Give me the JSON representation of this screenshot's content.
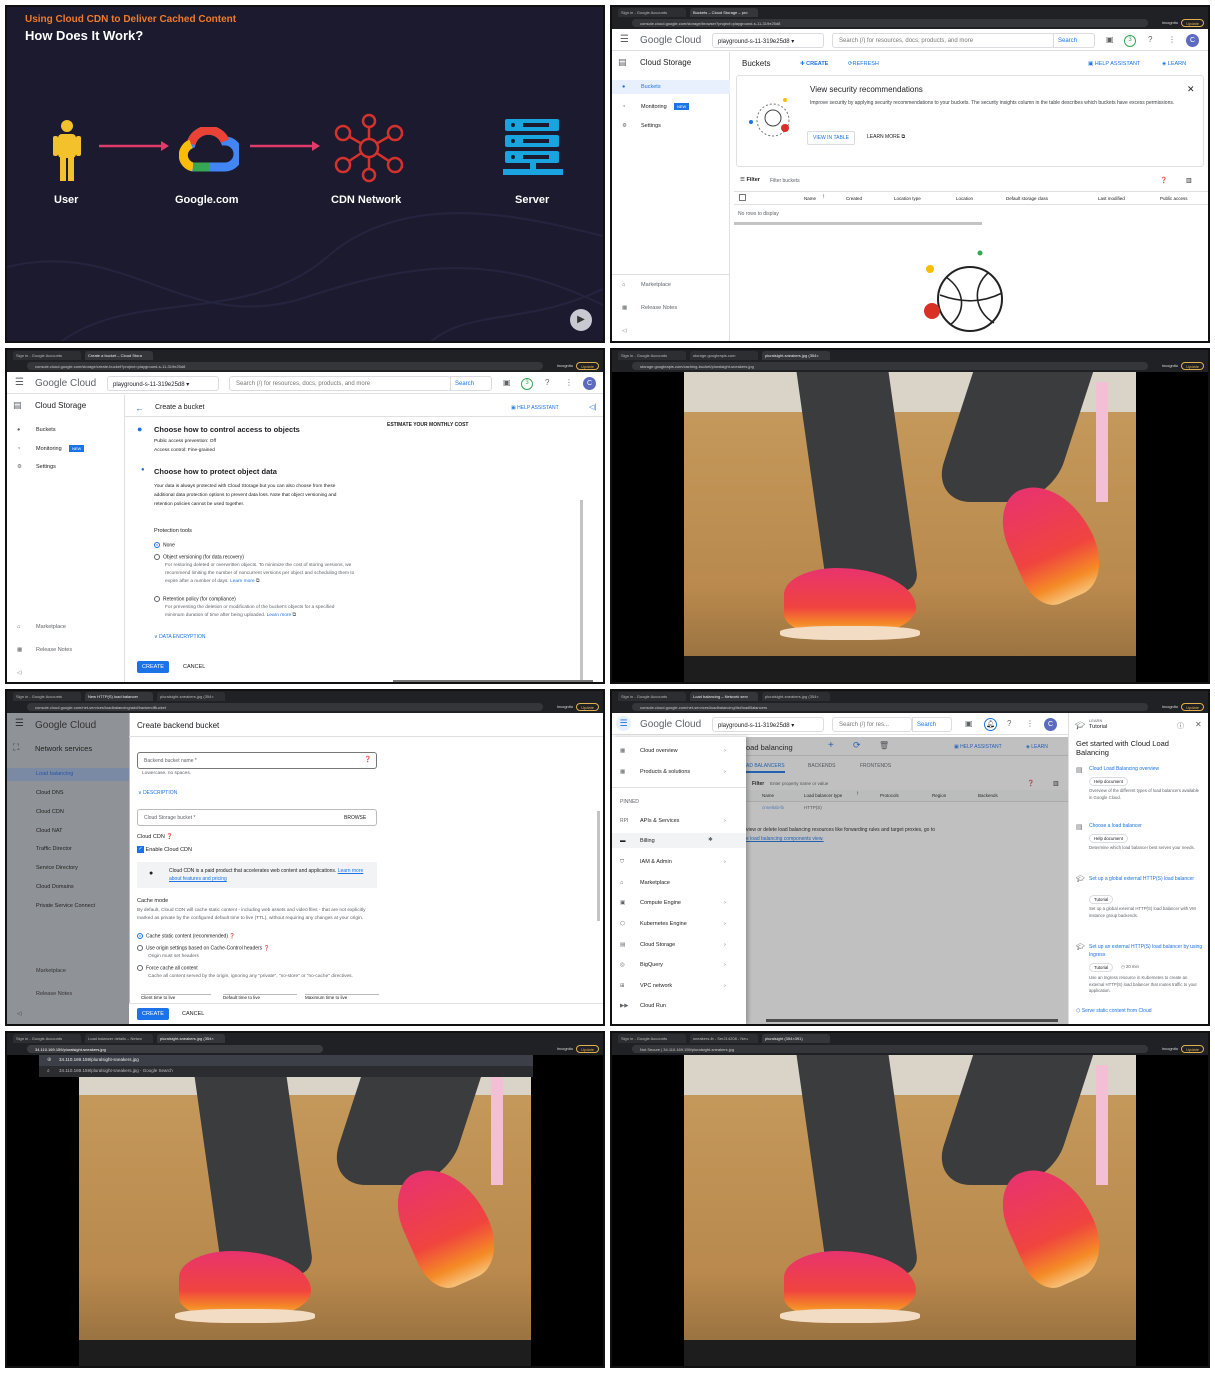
{
  "slide": {
    "subtitle": "Using Cloud CDN to Deliver Cached Content",
    "title": "How Does It Work?",
    "labels": [
      "User",
      "Google.com",
      "CDN Network",
      "Server"
    ],
    "colors": {
      "bg": "#1b1a2e",
      "accent": "#ef7b2b",
      "arrow": "#e23b6b",
      "user": "#f3c12c",
      "server": "#19a4e0",
      "cdn": "#d6322c"
    }
  },
  "browser": {
    "update": "Update",
    "incognito": "Incognito",
    "tab_signin": "Sign in - Google Accounts"
  },
  "p2": {
    "tab2": "Buckets – Cloud Storage – pro",
    "url": "console.cloud.google.com/storage/browser?project=playground-s-11-319e25d8",
    "logo": "Google Cloud",
    "project": "playground-s-11-319e25d8",
    "search_placeholder": "Search (/) for resources, docs, products, and more",
    "search_btn": "Search",
    "badge": "3",
    "avatar": "C",
    "product": "Cloud Storage",
    "nav": [
      "Buckets",
      "Monitoring",
      "Settings"
    ],
    "new_badge": "NEW",
    "bottom_nav": [
      "Marketplace",
      "Release Notes"
    ],
    "page_title": "Buckets",
    "create": "CREATE",
    "refresh": "REFRESH",
    "help": "HELP ASSISTANT",
    "learn": "LEARN",
    "rec_title": "View security recommendations",
    "rec_body": "Improve security by applying security recommendations to your buckets. The security insights column in the table describes which buckets have excess permissions.",
    "view_table": "VIEW IN TABLE",
    "learn_more": "LEARN MORE",
    "filter": "Filter",
    "filter_ph": "Filter buckets",
    "cols": [
      "Name",
      "Created",
      "Location type",
      "Location",
      "Default storage class",
      "Last modified",
      "Public access"
    ],
    "empty": "No rows to display"
  },
  "p3": {
    "tab2": "Create a bucket – Cloud Stora",
    "url": "console.cloud.google.com/storage/create-bucket?project=playground-s-11-319e25d8",
    "page_title": "Create a bucket",
    "help": "HELP ASSISTANT",
    "estimate": "ESTIMATE YOUR MONTHLY COST",
    "s1": "Choose how to control access to objects",
    "s1_l1": "Public access prevention: Off",
    "s1_l2": "Access control: Fine-grained",
    "s2": "Choose how to protect object data",
    "s2_body": "Your data is always protected with Cloud Storage but you can also choose from these additional data protection options to prevent data loss. Note that object versioning and retention policies cannot be used together.",
    "tools": "Protection tools",
    "opt1": "None",
    "opt2": "Object versioning (for data recovery)",
    "opt2_desc": "For restoring deleted or overwritten objects. To minimize the cost of storing versions, we recommend limiting the number of noncurrent versions per object and scheduling them to expire after a number of days.",
    "opt3": "Retention policy (for compliance)",
    "opt3_desc": "For preventing the deletion or modification of the bucket's objects for a specified minimum duration of time after being uploaded.",
    "learn_more": "Learn more",
    "encryption": "DATA ENCRYPTION",
    "create": "CREATE",
    "cancel": "CANCEL"
  },
  "p4": {
    "tab2": "storage.googleapis.com",
    "tab3": "pluralsight-sneakers.jpg (354×",
    "url": "storage.googleapis.com/caching-bucket/pluralsight-sneakers.jpg"
  },
  "p5": {
    "tab2": "New HTTP(S) load balancer",
    "tab3": "pluralsight-sneakers.jpg (354×",
    "url": "console.cloud.google.com/net-services/loadbalancing/add/backendBucket",
    "product": "Network services",
    "nav": [
      "Load balancing",
      "Cloud DNS",
      "Cloud CDN",
      "Cloud NAT",
      "Traffic Director",
      "Service Directory",
      "Cloud Domains",
      "Private Service Connect"
    ],
    "bottom_nav": [
      "Marketplace",
      "Release Notes"
    ],
    "title": "Create backend bucket",
    "name_ph": "Backend bucket name *",
    "name_hint": "Lowercase, no spaces.",
    "description": "DESCRIPTION",
    "bucket_ph": "Cloud Storage bucket *",
    "browse": "BROWSE",
    "cdn": "Cloud CDN",
    "enable": "Enable Cloud CDN",
    "info": "Cloud CDN is a paid product that accelerates web content and applications.",
    "info_link": "Learn more about features and pricing",
    "cache_mode": "Cache mode",
    "cache_desc": "By default, Cloud CDN will cache static content - including web assets and video files - that are not explicitly marked as private by the configured default time to live (TTL), without requiring any changes at your origin.",
    "m1": "Cache static content (recommended)",
    "m2": "Use origin settings based on Cache-Control headers",
    "m2_hint": "Origin must set headers",
    "m3": "Force cache all content",
    "m3_hint": "Cache all content served by the origin, ignoring any \"private\", \"no-store\" or \"no-cache\" directives.",
    "ttl": [
      "Client time to live",
      "Default time to live",
      "Maximum time to live"
    ],
    "create": "CREATE",
    "cancel": "CANCEL"
  },
  "p6": {
    "tab2": "Load balancing – Network serv",
    "tab3": "pluralsight-sneakers.jpg (354×",
    "url": "console.cloud.google.com/net-services/loadbalancing/list/loadBalancers",
    "search_ph": "Search (/) for res...",
    "search_btn": "Search",
    "menu": [
      "Cloud overview",
      "Products & solutions"
    ],
    "pinned": "PINNED",
    "pinned_items": [
      "APIs & Services",
      "Billing",
      "IAM & Admin",
      "Marketplace",
      "Compute Engine",
      "Kubernetes Engine",
      "Cloud Storage",
      "BigQuery",
      "VPC network",
      "Cloud Run"
    ],
    "page_title": "oad balancing",
    "help": "HELP ASSISTANT",
    "learn": "LEARN",
    "tabs": [
      "AD BALANCERS",
      "BACKENDS",
      "FRONTENDS"
    ],
    "filter": "Filter",
    "filter_ph": "Enter property name or value",
    "cols": [
      "Name",
      "Load balancer type",
      "Protocols",
      "Region",
      "Backends"
    ],
    "row": [
      "cnnetlab-lb",
      "HTTP(S)"
    ],
    "msg": "view or delete load balancing resources like forwarding rules and target proxies, go to",
    "msg_link": "e load balancing components view.",
    "panel_kicker": "LEARN",
    "panel_title": "Tutorial",
    "panel_head": "Get started with Cloud Load Balancing",
    "cards": [
      {
        "title": "Cloud Load Balancing overview",
        "tag": "Help document",
        "body": "Overview of the different types of load balancers available in Google Cloud."
      },
      {
        "title": "Choose a load balancer",
        "tag": "Help document",
        "body": "Determine which load balancer best serves your needs."
      },
      {
        "title": "Set up a global external HTTP(S) load balancer",
        "tag": "Tutorial",
        "body": "Set up a global external HTTP(S) load balancer with VM instance group backends."
      },
      {
        "title": "Set up an external HTTP(S) load balancer by using Ingress",
        "tag": "Tutorial",
        "time": "20 min",
        "body": "Use an Ingress resource in Kubernetes to create an external HTTP(S) load balancer that routes traffic to your application."
      }
    ],
    "last_link": "Serve static content from Cloud"
  },
  "p7": {
    "tab2": "Load balancer details – Netwo",
    "tab3": "pluralsight-sneakers.jpg (354×",
    "url": "34.110.169.159/pluralsight-sneakers.jpg",
    "suggest1": "34.110.169.159/pluralsight-sneakers.jpg",
    "suggest2": "34.110.169.159/pluralsight-sneakers.jpg - Google Search"
  },
  "p8": {
    "tab2": "sneakers-lb - Ser214208 - Neu",
    "tab3": "pluralsight (354×391)",
    "url": "Not Secure | 34.110.169.159/pluralsight-sneakers.jpg"
  }
}
